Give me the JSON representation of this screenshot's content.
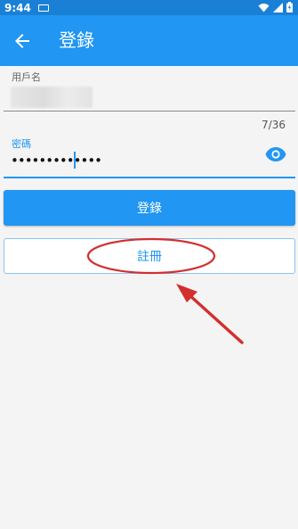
{
  "status_bar": {
    "time": "9:44"
  },
  "app_bar": {
    "title": "登錄"
  },
  "form": {
    "username_label": "用戶名",
    "password_label": "密碼",
    "password_value": "•••••••••••••",
    "char_counter": "7/36"
  },
  "buttons": {
    "login_label": "登錄",
    "register_label": "註冊"
  },
  "colors": {
    "primary": "#2196f3",
    "status_bar": "#1a80d6",
    "annotation": "#d32f2f"
  },
  "icons": [
    "back-arrow-icon",
    "visibility-eye-icon",
    "wifi-icon",
    "cellular-signal-icon",
    "battery-icon"
  ]
}
